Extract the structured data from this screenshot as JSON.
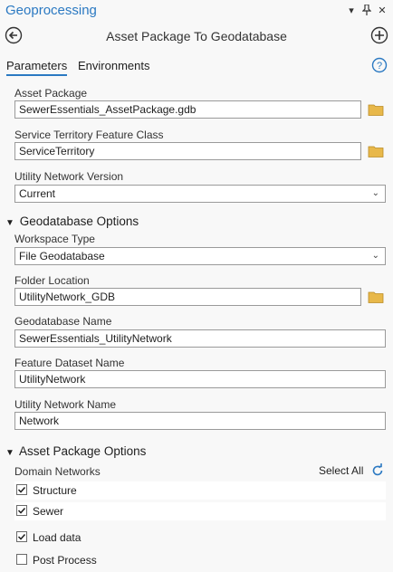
{
  "pane": {
    "title": "Geoprocessing"
  },
  "header_buttons": {
    "options": "▾",
    "pin": "📌",
    "close": "✕"
  },
  "tool": {
    "title": "Asset Package To Geodatabase"
  },
  "tabs": [
    {
      "label": "Parameters",
      "active": true
    },
    {
      "label": "Environments",
      "active": false
    }
  ],
  "fields": {
    "asset_package": {
      "label": "Asset Package",
      "value": "SewerEssentials_AssetPackage.gdb"
    },
    "service_territory": {
      "label": "Service Territory Feature Class",
      "value": "ServiceTerritory"
    },
    "un_version": {
      "label": "Utility Network Version",
      "value": "Current"
    }
  },
  "geodatabase_options": {
    "header": "Geodatabase Options",
    "workspace_type": {
      "label": "Workspace Type",
      "value": "File Geodatabase"
    },
    "folder_location": {
      "label": "Folder Location",
      "value": "UtilityNetwork_GDB"
    },
    "gdb_name": {
      "label": "Geodatabase Name",
      "value": "SewerEssentials_UtilityNetwork"
    },
    "dataset_name": {
      "label": "Feature Dataset Name",
      "value": "UtilityNetwork"
    },
    "un_name": {
      "label": "Utility Network Name",
      "value": "Network"
    }
  },
  "asset_package_options": {
    "header": "Asset Package Options",
    "domain_networks_label": "Domain Networks",
    "select_all": "Select All",
    "domain_networks": [
      {
        "label": "Structure",
        "checked": true
      },
      {
        "label": "Sewer",
        "checked": true
      }
    ],
    "load_data": {
      "label": "Load data",
      "checked": true
    },
    "post_process": {
      "label": "Post Process",
      "checked": false
    }
  },
  "colors": {
    "accent": "#2b79c2",
    "folder": "#e8b84a"
  }
}
